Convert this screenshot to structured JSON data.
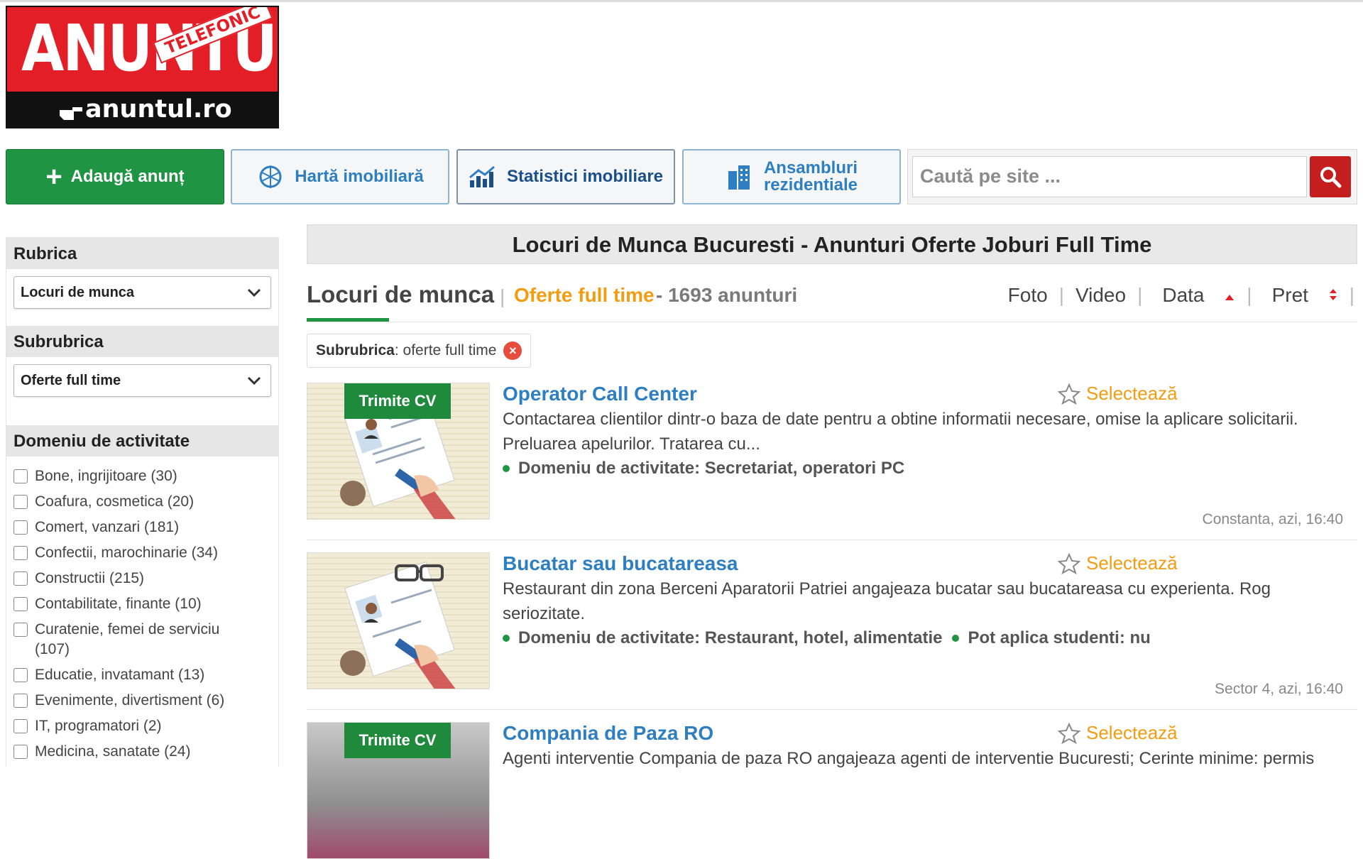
{
  "logo": {
    "main": "ANUNTUL",
    "ribbon": "TELEFONIC",
    "domain": "anuntul.ro"
  },
  "nav": {
    "add_label": "Adaugă anunț",
    "map_label": "Hartă imobiliară",
    "stats_label": "Statistici imobiliare",
    "ans_line1": "Ansambluri",
    "ans_line2": "rezidentiale"
  },
  "search": {
    "placeholder": "Caută pe site ..."
  },
  "sidebar": {
    "rubrica_heading": "Rubrica",
    "rubrica_selected": "Locuri de munca",
    "subrubrica_heading": "Subrubrica",
    "subrubrica_selected": "Oferte full time",
    "domeniu_heading": "Domeniu de activitate",
    "domains": [
      "Bone, ingrijitoare (30)",
      "Coafura, cosmetica (20)",
      "Comert, vanzari (181)",
      "Confectii, marochinarie (34)",
      "Constructii (215)",
      "Contabilitate, finante (10)",
      "Curatenie, femei de serviciu (107)",
      "Educatie, invatamant (13)",
      "Evenimente, divertisment (6)",
      "IT, programatori (2)",
      "Medicina, sanatate (24)"
    ]
  },
  "main": {
    "page_title": "Locuri de Munca Bucuresti - Anunturi Oferte Joburi Full Time",
    "category": "Locuri de munca",
    "separator": "|",
    "subcategory": "Oferte full time",
    "count": "- 1693 anunturi",
    "sort": {
      "foto": "Foto",
      "video": "Video",
      "data": "Data",
      "pret": "Pret"
    },
    "filter_key": "Subrubrica",
    "filter_value": ": oferte full time"
  },
  "listings": [
    {
      "badge": "Trimite CV",
      "title": "Operator Call Center",
      "select_label": "Selectează",
      "desc_line1": "Contactarea clientilor dintr-o baza de date pentru a obtine informatii necesare, omise la aplicare solicitarii.",
      "desc_line2": "Preluarea apelurilor. Tratarea cu...",
      "meta1": "Domeniu de activitate: Secretariat, operatori PC",
      "location": "Constanta, azi, 16:40"
    },
    {
      "badge": "",
      "title": "Bucatar sau bucatareasa",
      "select_label": "Selectează",
      "desc_line1": "Restaurant din zona Berceni Aparatorii Patriei angajeaza bucatar sau bucatareasa cu experienta. Rog",
      "desc_line2": "seriozitate.",
      "meta1": "Domeniu de activitate: Restaurant, hotel, alimentatie",
      "meta2": "Pot aplica studenti: nu",
      "location": "Sector 4, azi, 16:40"
    },
    {
      "badge": "Trimite CV",
      "title": "Compania de Paza RO",
      "select_label": "Selectează",
      "desc_line1": "Agenti interventie Compania de paza RO angajeaza agenti de interventie Bucuresti; Cerinte minime: permis"
    }
  ],
  "colors": {
    "brand_red": "#e41e26",
    "green": "#1f9443",
    "link_blue": "#2e7fc1",
    "orange": "#f39c12"
  }
}
